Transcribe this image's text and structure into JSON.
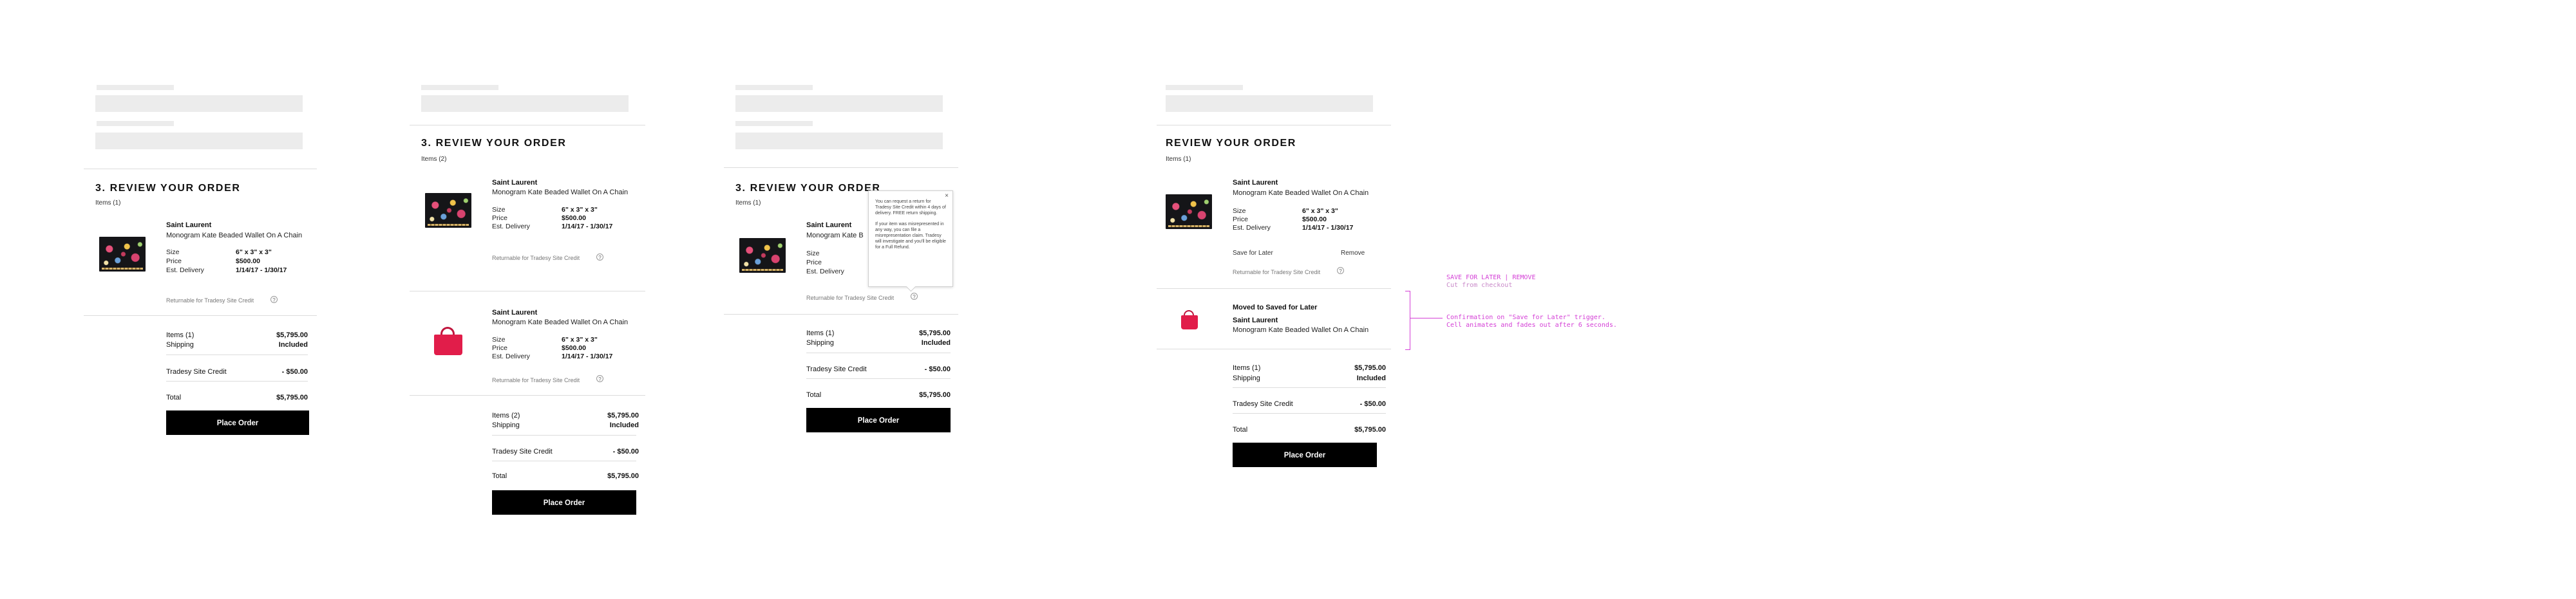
{
  "common": {
    "brand": "Saint Laurent",
    "product": "Monogram Kate Beaded Wallet On A Chain",
    "size_label": "Size",
    "size_value": "6\" x 3\" x 3\"",
    "price_label": "Price",
    "price_value": "$500.00",
    "delivery_label": "Est. Delivery",
    "delivery_value": "1/14/17 - 1/30/17",
    "returnable": "Returnable for Tradesy Site Credit",
    "info_glyph": "?",
    "shipping_label": "Shipping",
    "shipping_value": "Included",
    "credit_label": "Tradesy Site Credit",
    "credit_value": "- $50.00",
    "total_label": "Total",
    "total_value": "$5,795.00",
    "subtotal_value": "$5,795.00",
    "place_order": "Place Order"
  },
  "panel1": {
    "title": "3. REVIEW YOUR ORDER",
    "items_count": "Items (1)",
    "items_row": "Items (1)"
  },
  "panel2": {
    "title": "3. REVIEW YOUR ORDER",
    "items_count": "Items (2)",
    "items_row": "Items (2)"
  },
  "panel3": {
    "title": "3. REVIEW YOUR ORDER",
    "items_count": "Items (1)",
    "items_row": "Items (1)",
    "product_truncated": "Monogram Kate B",
    "tooltip_close": "×",
    "tooltip_p1": "You can request a return for Tradesy Site Credit within 4 days of delivery. FREE return shipping.",
    "tooltip_p2": "If your item was misrepresented in any way, you can file a misrepresentation claim. Tradesy will investigate and you'll be eligible for a Full Refund."
  },
  "panel4": {
    "title": "REVIEW YOUR ORDER",
    "items_count": "Items (1)",
    "items_row": "Items (1)",
    "save_for_later": "Save for Later",
    "remove": "Remove",
    "moved_label": "Moved to Saved for Later"
  },
  "annotations": {
    "note1_line1": "SAVE FOR LATER | REMOVE",
    "note1_line2": "Cut from checkout",
    "note2_line1": "Confirmation on \"Save for Later\" trigger.",
    "note2_line2": "Cell animates and fades out after 6 seconds."
  },
  "colors": {
    "accent_annotation": "#d43fd6",
    "button_bg": "#000000",
    "skeleton": "#ececec"
  },
  "icons": {
    "info": "info-icon",
    "close": "close-icon",
    "product_wallet": "floral-wallet-thumbnail",
    "product_bag": "pink-bag-thumbnail"
  }
}
